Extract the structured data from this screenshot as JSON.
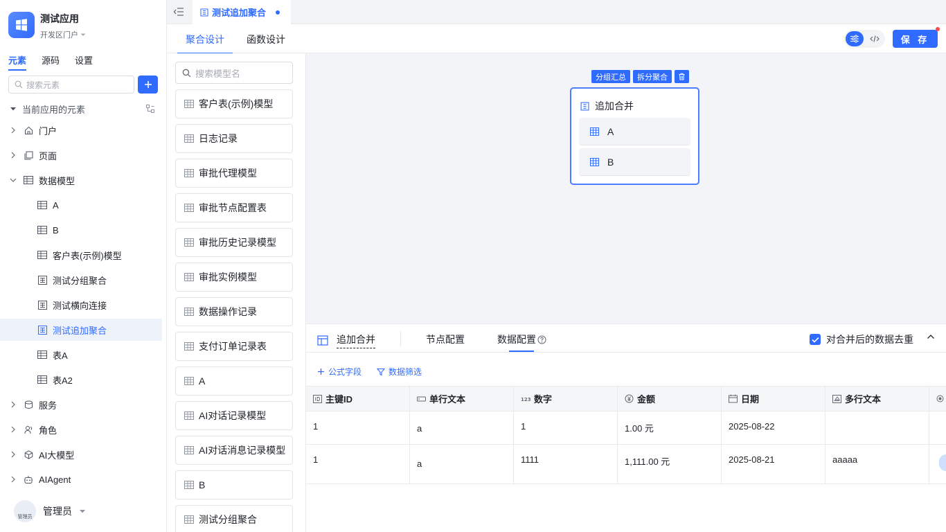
{
  "app": {
    "name": "测试应用",
    "portal": "开发区门户"
  },
  "sidebar": {
    "tabs": [
      "元素",
      "源码",
      "设置"
    ],
    "search_placeholder": "搜索元素",
    "section_title": "当前应用的元素",
    "items": [
      {
        "label": "门户",
        "icon": "home-icon",
        "indent": 0,
        "chevron": "right"
      },
      {
        "label": "页面",
        "icon": "page-icon",
        "indent": 0,
        "chevron": "right"
      },
      {
        "label": "数据模型",
        "icon": "table-icon",
        "indent": 0,
        "chevron": "down"
      },
      {
        "label": "A",
        "icon": "table-icon",
        "indent": 1
      },
      {
        "label": "B",
        "icon": "table-icon",
        "indent": 1
      },
      {
        "label": "客户表(示例)模型",
        "icon": "table-icon",
        "indent": 1
      },
      {
        "label": "测试分组聚合",
        "icon": "aggregate-icon",
        "indent": 1
      },
      {
        "label": "测试横向连接",
        "icon": "aggregate-icon",
        "indent": 1
      },
      {
        "label": "测试追加聚合",
        "icon": "aggregate-icon",
        "indent": 1,
        "active": true
      },
      {
        "label": "表A",
        "icon": "table-icon",
        "indent": 1
      },
      {
        "label": "表A2",
        "icon": "table-icon",
        "indent": 1
      },
      {
        "label": "服务",
        "icon": "service-icon",
        "indent": 0,
        "chevron": "right"
      },
      {
        "label": "角色",
        "icon": "role-icon",
        "indent": 0,
        "chevron": "right"
      },
      {
        "label": "AI大模型",
        "icon": "ai-model-icon",
        "indent": 0,
        "chevron": "right"
      },
      {
        "label": "AIAgent",
        "icon": "robot-icon",
        "indent": 0,
        "chevron": "right"
      }
    ],
    "user": {
      "name": "管理员",
      "avatar_text": "管理员"
    }
  },
  "tabbar": {
    "active_tab": "测试追加聚合"
  },
  "subbar": {
    "tabs": [
      "聚合设计",
      "函数设计"
    ],
    "save_label": "保 存"
  },
  "models": {
    "search_placeholder": "搜索模型名",
    "items": [
      "客户表(示例)模型",
      "日志记录",
      "审批代理模型",
      "审批节点配置表",
      "审批历史记录模型",
      "审批实例模型",
      "数据操作记录",
      "支付订单记录表",
      "A",
      "AI对话记录模型",
      "AI对话消息记录模型",
      "B",
      "测试分组聚合"
    ]
  },
  "canvas": {
    "actions": [
      "分组汇总",
      "拆分聚合"
    ],
    "node_title": "追加合并",
    "children": [
      "A",
      "B"
    ]
  },
  "panel": {
    "title": "追加合并",
    "tabs": [
      "节点配置",
      "数据配置"
    ],
    "dedup_label": "对合并后的数据去重",
    "tools": [
      "公式字段",
      "数据筛选"
    ],
    "columns": [
      {
        "label": "主键ID",
        "icon": "id-icon"
      },
      {
        "label": "单行文本",
        "icon": "text-icon"
      },
      {
        "label": "数字",
        "icon": "number-icon"
      },
      {
        "label": "金额",
        "icon": "currency-icon"
      },
      {
        "label": "日期",
        "icon": "date-icon"
      },
      {
        "label": "多行文本",
        "icon": "multiline-icon"
      }
    ],
    "rows": [
      [
        "1",
        "a",
        "1",
        "1.00 元",
        "2025-08-22",
        ""
      ],
      [
        "1",
        "a",
        "1111",
        "1,111.00 元",
        "2025-08-21",
        "aaaaa"
      ]
    ]
  },
  "colors": {
    "accent": "#2f6bff",
    "canvas_bg": "#f2f4f8"
  }
}
